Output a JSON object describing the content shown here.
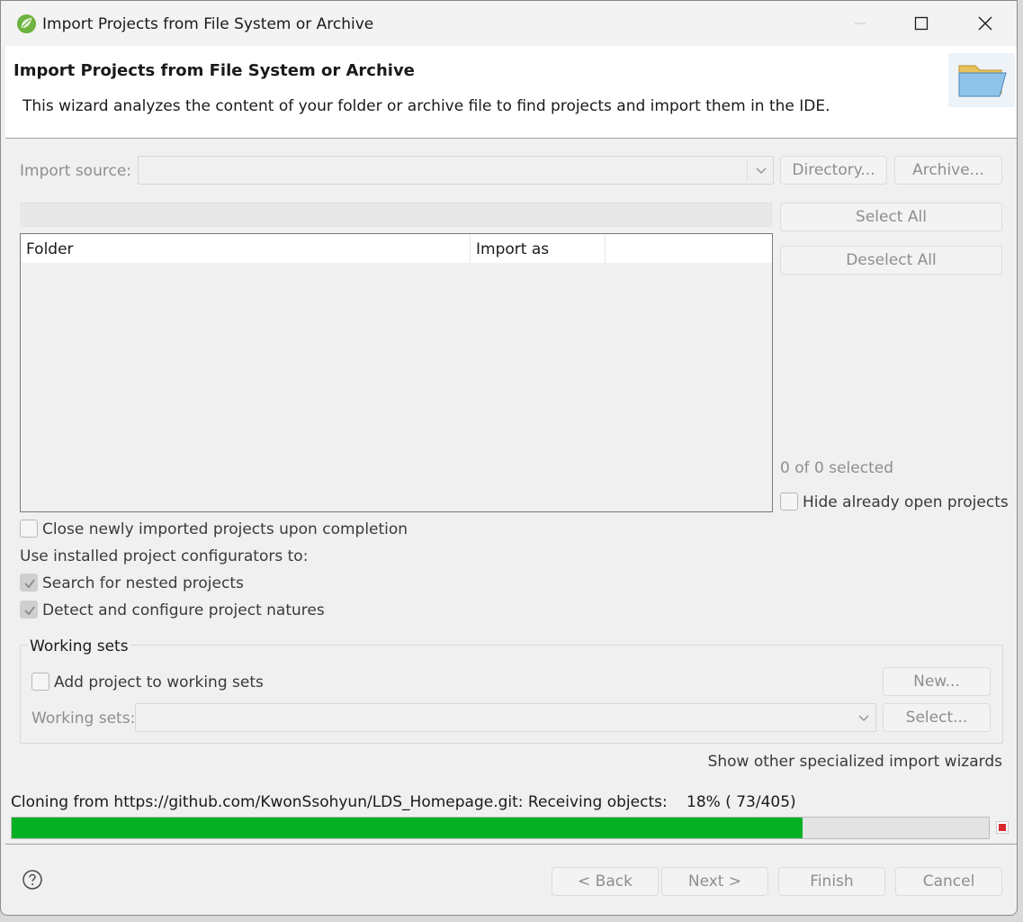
{
  "window": {
    "title": "Import Projects from File System or Archive",
    "app_icon": "spring-leaf-icon",
    "controls": [
      "minimize-icon",
      "maximize-icon",
      "close-icon"
    ]
  },
  "header": {
    "title": "Import Projects from File System or Archive",
    "description": "This wizard analyzes the content of your folder or archive file to find projects and import them in the IDE.",
    "icon": "folder-open-icon"
  },
  "import_source": {
    "label": "Import source:",
    "value": "",
    "directory_button": "Directory...",
    "archive_button": "Archive..."
  },
  "table": {
    "columns": [
      "Folder",
      "Import as",
      ""
    ],
    "rows": []
  },
  "side_actions": {
    "select_all": "Select All",
    "deselect_all": "Deselect All",
    "selection_count": "0 of 0 selected",
    "hide_open_label": "Hide already open projects"
  },
  "options": {
    "close_newly_label": "Close newly imported projects upon completion",
    "configurators_label": "Use installed project configurators to:",
    "nested_label": "Search for nested projects",
    "natures_label": "Detect and configure project natures"
  },
  "working_sets": {
    "group_label": "Working sets",
    "add_label": "Add project to working sets",
    "new_button": "New...",
    "sets_label": "Working sets:",
    "select_button": "Select..."
  },
  "specialized_link": "Show other specialized import wizards",
  "progress": {
    "message": "Cloning from https://github.com/KwonSsohyun/LDS_Homepage.git: Receiving objects:",
    "percent_text": "18% ( 73/405)",
    "fraction": 0.18,
    "color": "#06b025"
  },
  "footer": {
    "help_icon": "help-icon",
    "back": "< Back",
    "next": "Next >",
    "finish": "Finish",
    "cancel": "Cancel"
  }
}
